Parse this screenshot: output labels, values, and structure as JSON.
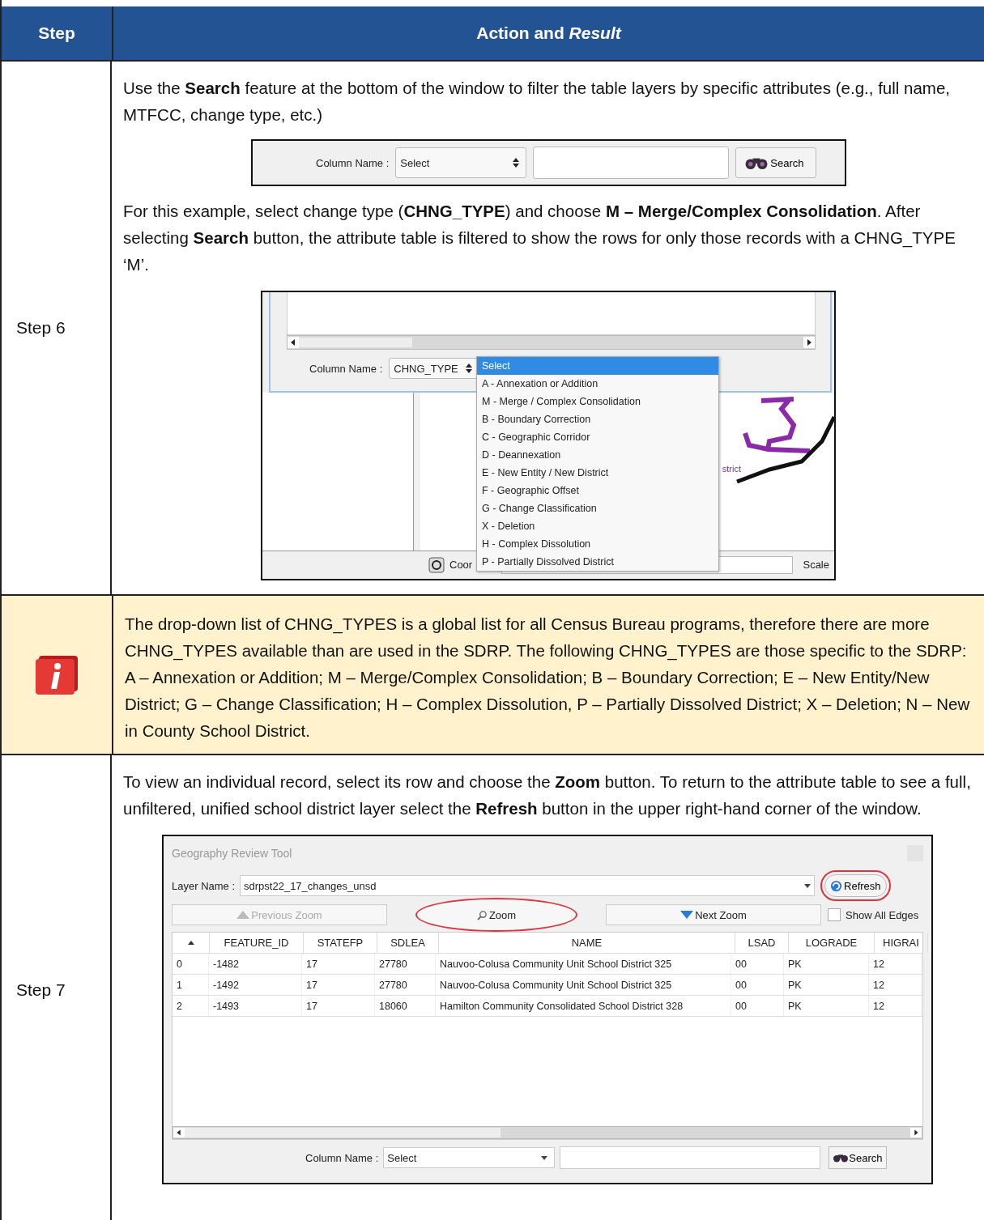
{
  "table": {
    "columns": [
      "Step",
      "Action and *Result*"
    ],
    "rows": [
      {
        "kind": "step",
        "step": "Step 6",
        "blocks": [
          {
            "kind": "paragraph",
            "text": "Use the **Search** feature at the bottom of the window to filter the table layers by specific attributes (e.g., full name, MTFCC, change type, etc.)"
          },
          {
            "kind": "search_bar_shot",
            "label": "Column Name :",
            "select": "Select",
            "button": "Search"
          },
          {
            "kind": "paragraph",
            "text": "For this example, select change type (**CHNG_TYPE**) and choose **M – Merge/Complex Consolidation**. After selecting **Search** button, the attribute table is filtered to show the rows for only those records with a CHNG_TYPE ‘M’."
          },
          {
            "kind": "dropdown_shot",
            "label": "Column Name :",
            "select": "CHNG_TYPE",
            "map_label": "strict",
            "coord_label": "Coor",
            "scale_label": "Scale",
            "options": [
              {
                "text": "Select",
                "selected": true
              },
              {
                "text": "A - Annexation or Addition",
                "selected": false
              },
              {
                "text": "M - Merge / Complex Consolidation",
                "selected": false
              },
              {
                "text": "B - Boundary Correction",
                "selected": false
              },
              {
                "text": "C - Geographic Corridor",
                "selected": false
              },
              {
                "text": "D - Deannexation",
                "selected": false
              },
              {
                "text": "E - New Entity / New District",
                "selected": false
              },
              {
                "text": "F - Geographic Offset",
                "selected": false
              },
              {
                "text": "G - Change Classification",
                "selected": false
              },
              {
                "text": "X - Deletion",
                "selected": false
              },
              {
                "text": "H - Complex Dissolution",
                "selected": false
              },
              {
                "text": "P - Partially Dissolved District",
                "selected": false
              }
            ]
          }
        ]
      },
      {
        "kind": "note",
        "text": "The drop-down list of CHNG_TYPES is a global list for all Census Bureau programs, therefore there are more CHNG_TYPES available than are used in the SDRP. The following CHNG_TYPES are those specific to the SDRP: A – Annexation or Addition; M – Merge/Complex Consolidation; B – Boundary Correction; E – New Entity/New District; G – Change Classification; H – Complex Dissolution, P – Partially Dissolved District; X – Deletion; N – New in County School District."
      },
      {
        "kind": "step",
        "step": "Step 7",
        "blocks": [
          {
            "kind": "paragraph",
            "text": "To view an individual record, select its row and choose the **Zoom** button. To return to the attribute table to see a full, unfiltered, unified school district layer select the **Refresh** button in the upper right-hand corner of the window."
          },
          {
            "kind": "tool_shot",
            "title": "Geography Review Tool",
            "layer_label": "Layer Name :",
            "layer_value": "sdrpst22_17_changes_unsd",
            "refresh": {
              "text": "Refresh",
              "circled": true
            },
            "nav": [
              {
                "kind": "prev",
                "text": "Previous Zoom",
                "disabled": true,
                "circled": false
              },
              {
                "kind": "zoom",
                "text": "Zoom",
                "disabled": false,
                "circled": true
              },
              {
                "kind": "next",
                "text": "Next Zoom",
                "disabled": false,
                "circled": false
              }
            ],
            "show_all_edges": {
              "label": "Show All Edges",
              "checked": false
            },
            "columns": [
              "",
              "FEATURE_ID",
              "STATEFP",
              "SDLEA",
              "NAME",
              "LSAD",
              "LOGRADE",
              "HIGRAI"
            ],
            "rows": [
              [
                "0",
                "-1482",
                "17",
                "27780",
                "Nauvoo-Colusa Community Unit School District 325",
                "00",
                "PK",
                "12"
              ],
              [
                "1",
                "-1492",
                "17",
                "27780",
                "Nauvoo-Colusa Community Unit School District 325",
                "00",
                "PK",
                "12"
              ],
              [
                "2",
                "-1493",
                "17",
                "18060",
                "Hamilton Community Consolidated School District 328",
                "00",
                "PK",
                "12"
              ]
            ],
            "search_label": "Column Name :",
            "search_select": "Select",
            "search_button": "Search"
          }
        ]
      }
    ]
  }
}
